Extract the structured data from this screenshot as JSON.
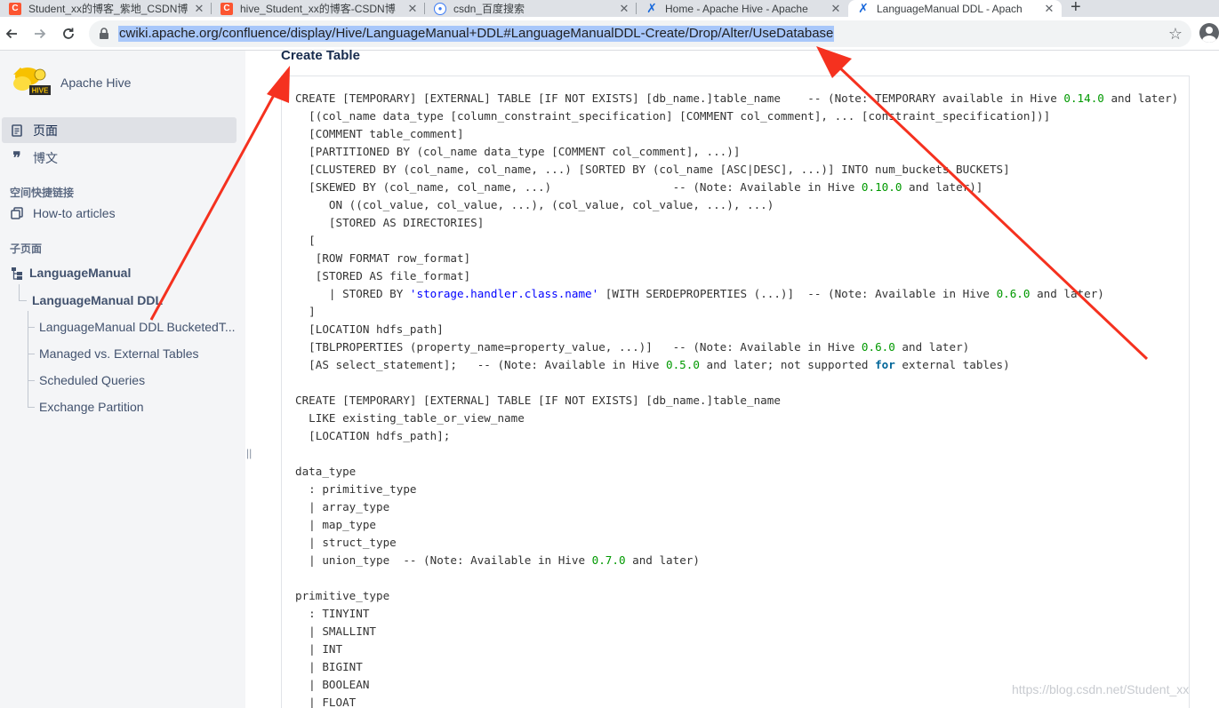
{
  "browser": {
    "tabs": [
      {
        "title": "Student_xx的博客_紫地_CSDN博",
        "icon": "csdn-icon",
        "active": false
      },
      {
        "title": "hive_Student_xx的博客-CSDN博",
        "icon": "csdn-icon",
        "active": false
      },
      {
        "title": "csdn_百度搜索",
        "icon": "baidu-paw-icon",
        "active": false
      },
      {
        "title": "Home - Apache Hive - Apache",
        "icon": "confluence-icon",
        "active": false
      },
      {
        "title": "LanguageManual DDL - Apach",
        "icon": "confluence-icon",
        "active": true
      }
    ],
    "new_tab_label": "+",
    "url": "cwiki.apache.org/confluence/display/Hive/LanguageManual+DDL#LanguageManualDDL-Create/Drop/Alter/UseDatabase"
  },
  "sidebar": {
    "space_name": "Apache Hive",
    "logo_text": "HIVE",
    "nav": [
      {
        "label": "页面",
        "icon": "pages-icon",
        "selected": true
      },
      {
        "label": "博文",
        "icon": "quote-icon",
        "selected": false
      }
    ],
    "shortcuts_heading": "空间快捷链接",
    "shortcuts": [
      {
        "label": "How-to articles",
        "icon": "copy-icon"
      }
    ],
    "child_pages_heading": "子页面",
    "tree": {
      "root": "LanguageManual",
      "current": "LanguageManual DDL",
      "children": [
        "LanguageManual DDL BucketedT...",
        "Managed vs. External Tables",
        "Scheduled Queries",
        "Exchange Partition"
      ]
    }
  },
  "content": {
    "heading": "Create Table",
    "code_lines": [
      [
        {
          "t": "CREATE [TEMPORARY] [EXTERNAL] TABLE [IF NOT EXISTS] [db_name.]table_name    -- (Note: TEMPORARY available in Hive "
        },
        {
          "t": "0.14.0",
          "c": "num"
        },
        {
          "t": " and later)"
        }
      ],
      [
        {
          "t": "  [(col_name data_type [column_constraint_specification] [COMMENT col_comment], ... [constraint_specification])]"
        }
      ],
      [
        {
          "t": "  [COMMENT table_comment]"
        }
      ],
      [
        {
          "t": "  [PARTITIONED BY (col_name data_type [COMMENT col_comment], ...)]"
        }
      ],
      [
        {
          "t": "  [CLUSTERED BY (col_name, col_name, ...) [SORTED BY (col_name [ASC|DESC], ...)] INTO num_buckets BUCKETS]"
        }
      ],
      [
        {
          "t": "  [SKEWED BY (col_name, col_name, ...)                  -- (Note: Available in Hive "
        },
        {
          "t": "0.10.0",
          "c": "num"
        },
        {
          "t": " and later)]"
        }
      ],
      [
        {
          "t": "     ON ((col_value, col_value, ...), (col_value, col_value, ...), ...)"
        }
      ],
      [
        {
          "t": "     [STORED AS DIRECTORIES]"
        }
      ],
      [
        {
          "t": "  ["
        }
      ],
      [
        {
          "t": "   [ROW FORMAT row_format]"
        }
      ],
      [
        {
          "t": "   [STORED AS file_format]"
        }
      ],
      [
        {
          "t": "     | STORED BY "
        },
        {
          "t": "'storage.handler.class.name'",
          "c": "str"
        },
        {
          "t": " [WITH SERDEPROPERTIES (...)]  -- (Note: Available in Hive "
        },
        {
          "t": "0.6.0",
          "c": "num"
        },
        {
          "t": " and later)"
        }
      ],
      [
        {
          "t": "  ]"
        }
      ],
      [
        {
          "t": "  [LOCATION hdfs_path]"
        }
      ],
      [
        {
          "t": "  [TBLPROPERTIES (property_name=property_value, ...)]   -- (Note: Available in Hive "
        },
        {
          "t": "0.6.0",
          "c": "num"
        },
        {
          "t": " and later)"
        }
      ],
      [
        {
          "t": "  [AS select_statement];   -- (Note: Available in Hive "
        },
        {
          "t": "0.5.0",
          "c": "num"
        },
        {
          "t": " and later; not supported "
        },
        {
          "t": "for",
          "c": "kw"
        },
        {
          "t": " external tables)"
        }
      ],
      [
        {
          "t": ""
        }
      ],
      [
        {
          "t": "CREATE [TEMPORARY] [EXTERNAL] TABLE [IF NOT EXISTS] [db_name.]table_name"
        }
      ],
      [
        {
          "t": "  LIKE existing_table_or_view_name"
        }
      ],
      [
        {
          "t": "  [LOCATION hdfs_path];"
        }
      ],
      [
        {
          "t": ""
        }
      ],
      [
        {
          "t": "data_type"
        }
      ],
      [
        {
          "t": "  : primitive_type"
        }
      ],
      [
        {
          "t": "  | array_type"
        }
      ],
      [
        {
          "t": "  | map_type"
        }
      ],
      [
        {
          "t": "  | struct_type"
        }
      ],
      [
        {
          "t": "  | union_type  -- (Note: Available in Hive "
        },
        {
          "t": "0.7.0",
          "c": "num"
        },
        {
          "t": " and later)"
        }
      ],
      [
        {
          "t": ""
        }
      ],
      [
        {
          "t": "primitive_type"
        }
      ],
      [
        {
          "t": "  : TINYINT"
        }
      ],
      [
        {
          "t": "  | SMALLINT"
        }
      ],
      [
        {
          "t": "  | INT"
        }
      ],
      [
        {
          "t": "  | BIGINT"
        }
      ],
      [
        {
          "t": "  | BOOLEAN"
        }
      ],
      [
        {
          "t": "  | FLOAT"
        }
      ]
    ]
  },
  "watermark": "https://blog.csdn.net/Student_xx",
  "colors": {
    "annotation_arrow": "#f5311f",
    "url_highlight": "#a8c7fa",
    "sidebar_bg": "#f4f5f7"
  }
}
